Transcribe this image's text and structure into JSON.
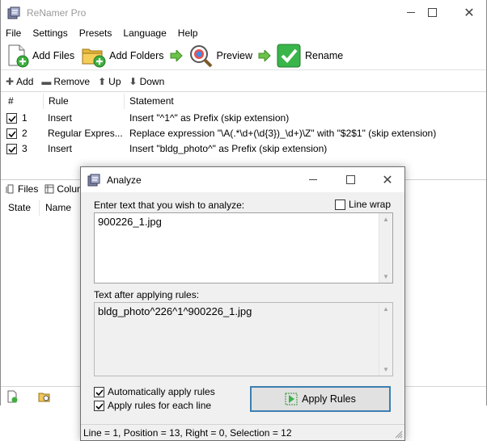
{
  "main_window": {
    "title": "ReNamer Pro",
    "menu": [
      "File",
      "Settings",
      "Presets",
      "Language",
      "Help"
    ],
    "toolbar": {
      "add_files": "Add Files",
      "add_folders": "Add Folders",
      "preview": "Preview",
      "rename": "Rename"
    },
    "rules_toolbar": {
      "add": "Add",
      "remove": "Remove",
      "up": "Up",
      "down": "Down"
    },
    "rules_table": {
      "columns": [
        "#",
        "Rule",
        "Statement"
      ],
      "rows": [
        {
          "checked": true,
          "num": "1",
          "rule": "Insert",
          "statement": "Insert \"^1^\" as Prefix (skip extension)"
        },
        {
          "checked": true,
          "num": "2",
          "rule": "Regular Expres...",
          "statement": "Replace expression \"\\A(.*\\d+(\\d{3})_\\d+)\\Z\" with \"$2$1\" (skip extension)"
        },
        {
          "checked": true,
          "num": "3",
          "rule": "Insert",
          "statement": "Insert \"bldg_photo^\" as Prefix (skip extension)"
        }
      ]
    },
    "files_toolbar": {
      "files": "Files",
      "columns": "Colum"
    },
    "files_table": {
      "columns": [
        "State",
        "Name"
      ]
    }
  },
  "analyze_dialog": {
    "title": "Analyze",
    "input_label": "Enter text that you wish to analyze:",
    "line_wrap_label": "Line wrap",
    "line_wrap_checked": false,
    "input_text": "900226_1.jpg",
    "output_label": "Text after applying rules:",
    "output_text": "bldg_photo^226^1^900226_1.jpg",
    "auto_apply_label": "Automatically apply rules",
    "auto_apply_checked": true,
    "each_line_label": "Apply rules for each line",
    "each_line_checked": true,
    "apply_button": "Apply Rules",
    "status": "Line = 1, Position = 13, Right = 0, Selection = 12"
  },
  "colors": {
    "accent_green": "#39b54a",
    "button_focus_border": "#3c7fb1",
    "dialog_bg": "#f0f0f0"
  }
}
